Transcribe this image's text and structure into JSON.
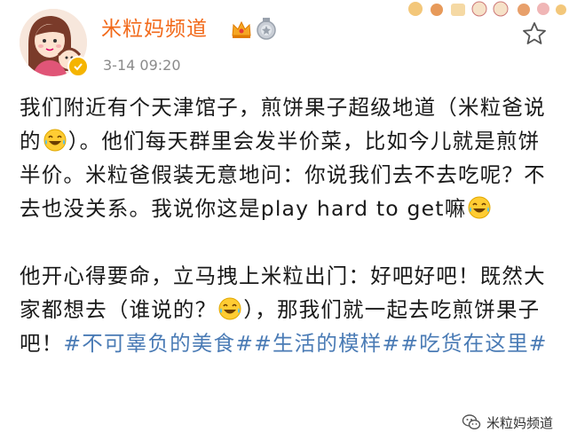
{
  "header": {
    "username": "米粒妈频道",
    "timestamp": "3-14 09:20"
  },
  "post": {
    "p1_a": "我们附近有个天津馆子，煎饼果子超级地道（米粒爸说的",
    "p1_b": "）。他们每天群里会发半价菜，比如今儿就是煎饼半价。米粒爸假装无意地问：你说我们去不去吃呢？不去也没关系。我说你这是play hard to get嘛",
    "p2_a": "他开心得要命，立马拽上米粒出门：好吧好吧！既然大家都想去（谁说的？",
    "p2_b": "），那我们就一起去吃煎饼果子吧！",
    "tag1": "#不可辜负的美食#",
    "tag2": "#生活的模样#",
    "tag3": "#吃货在这里#"
  },
  "watermark": {
    "label": "米粒妈频道"
  },
  "icons": {
    "avatar": "avatar-illustration",
    "verified": "verified-badge-icon",
    "crown": "crown-badge-icon",
    "medal": "medal-badge-icon",
    "star": "star-icon",
    "emoji": "laughing-crying-emoji"
  },
  "colors": {
    "username": "#f26a1b",
    "hashtag": "#4a7bb5",
    "timestamp": "#8a8a8a"
  }
}
